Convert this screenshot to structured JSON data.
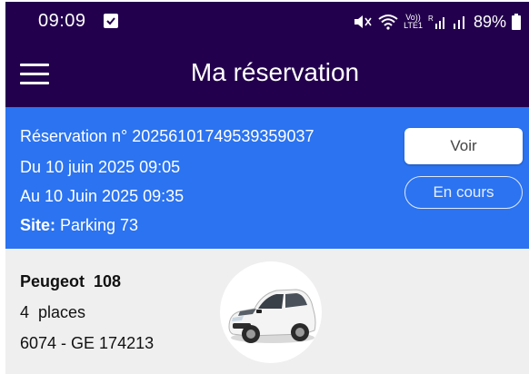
{
  "status_bar": {
    "time": "09:09",
    "battery": "89%",
    "volte_top": "Vo))",
    "volte_bottom": "LTE1"
  },
  "app_bar": {
    "title": "Ma réservation"
  },
  "reservation": {
    "number": "Réservation n° 20256101749539359037",
    "start": "Du 10 juin 2025 09:05",
    "end": "Au 10 Juin 2025 09:35",
    "site_label": "Site:",
    "site_value": " Parking 73",
    "view_button": "Voir",
    "status_button": "En cours"
  },
  "vehicle": {
    "name": "Peugeot  108",
    "seats": "4  places",
    "plate": "6074 - GE 174213",
    "image": "white-car-photo"
  },
  "colors": {
    "header": "#23004d",
    "banner": "#2b73f0",
    "vehicle_bg": "#efefef"
  }
}
